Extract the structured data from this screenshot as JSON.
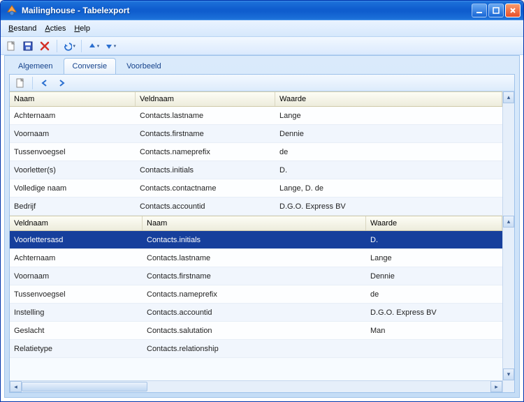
{
  "window": {
    "title": "Mailinghouse - Tabelexport"
  },
  "menu": {
    "bestand": "Bestand",
    "acties": "Acties",
    "help": "Help"
  },
  "tabs": {
    "algemeen": "Algemeen",
    "conversie": "Conversie",
    "voorbeeld": "Voorbeeld"
  },
  "table1": {
    "headers": {
      "naam": "Naam",
      "veldnaam": "Veldnaam",
      "waarde": "Waarde"
    },
    "rows": [
      {
        "naam": "Achternaam",
        "veldnaam": "Contacts.lastname",
        "waarde": "Lange"
      },
      {
        "naam": "Voornaam",
        "veldnaam": "Contacts.firstname",
        "waarde": "Dennie"
      },
      {
        "naam": "Tussenvoegsel",
        "veldnaam": "Contacts.nameprefix",
        "waarde": "de"
      },
      {
        "naam": "Voorletter(s)",
        "veldnaam": "Contacts.initials",
        "waarde": "D."
      },
      {
        "naam": "Volledige naam",
        "veldnaam": "Contacts.contactname",
        "waarde": "Lange, D. de"
      },
      {
        "naam": "Bedrijf",
        "veldnaam": "Contacts.accountid",
        "waarde": "D.G.O. Express BV"
      }
    ]
  },
  "table2": {
    "headers": {
      "veldnaam": "Veldnaam",
      "naam": "Naam",
      "waarde": "Waarde"
    },
    "rows": [
      {
        "veldnaam": "Voorlettersasd",
        "naam": "Contacts.initials",
        "waarde": "D.",
        "selected": true
      },
      {
        "veldnaam": "Achternaam",
        "naam": "Contacts.lastname",
        "waarde": "Lange"
      },
      {
        "veldnaam": "Voornaam",
        "naam": "Contacts.firstname",
        "waarde": "Dennie"
      },
      {
        "veldnaam": "Tussenvoegsel",
        "naam": "Contacts.nameprefix",
        "waarde": "de"
      },
      {
        "veldnaam": "Instelling",
        "naam": "Contacts.accountid",
        "waarde": "D.G.O. Express BV"
      },
      {
        "veldnaam": "Geslacht",
        "naam": "Contacts.salutation",
        "waarde": "Man"
      },
      {
        "veldnaam": "Relatietype",
        "naam": "Contacts.relationship",
        "waarde": ""
      }
    ]
  }
}
